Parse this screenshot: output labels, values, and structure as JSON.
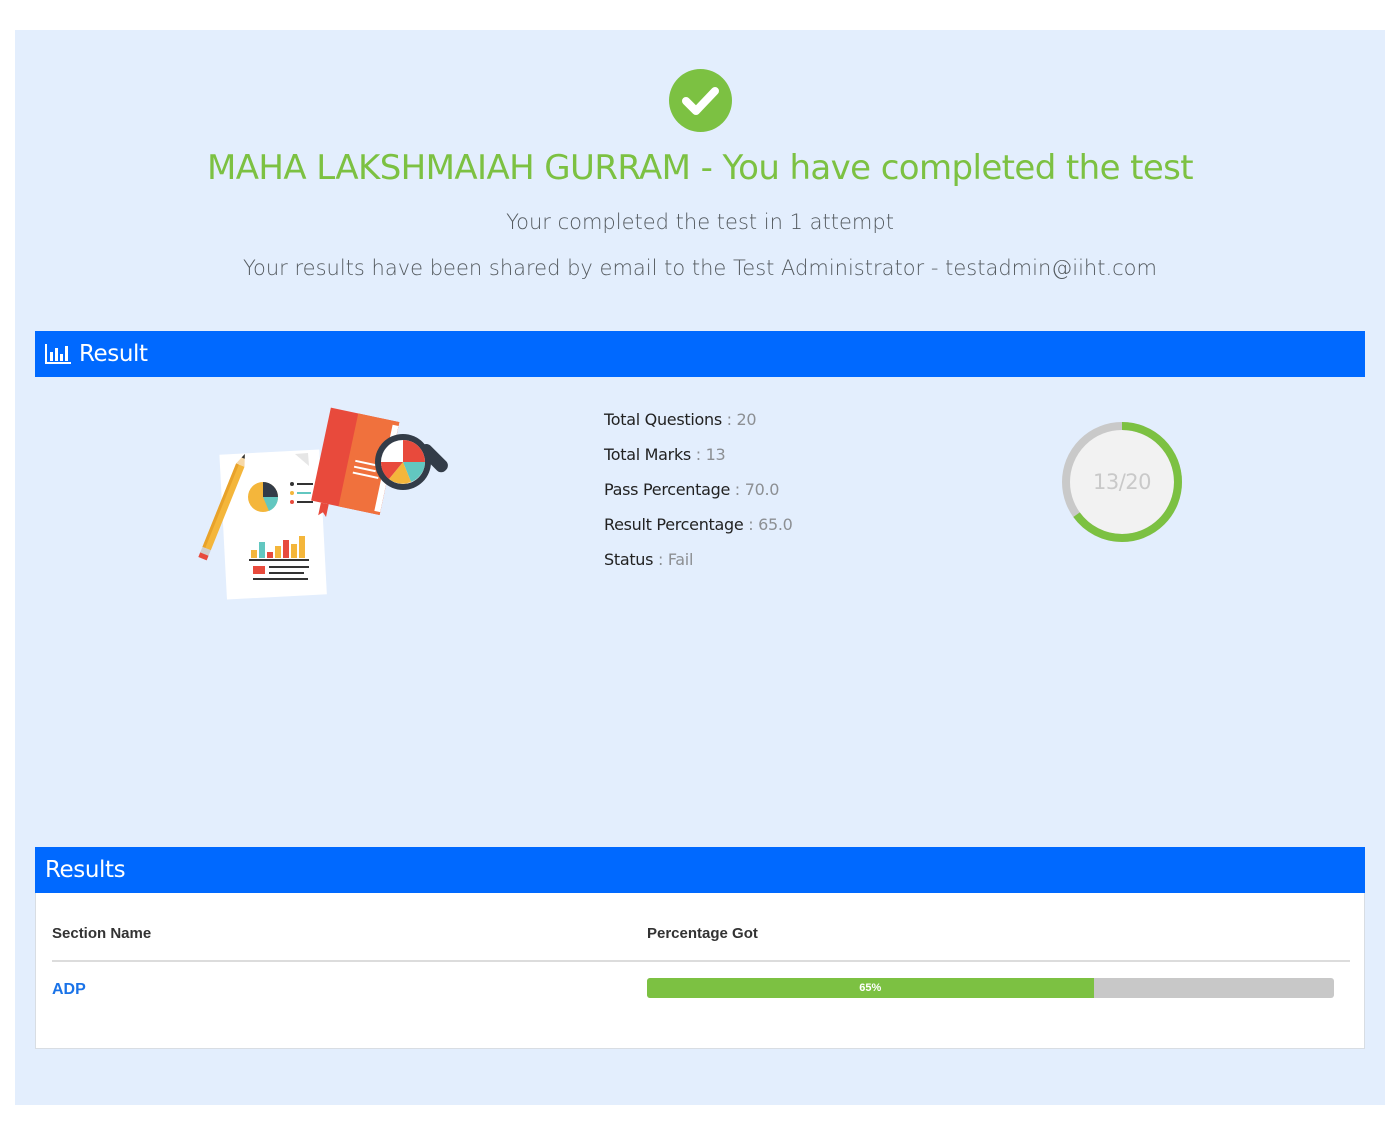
{
  "header": {
    "headline": "MAHA LAKSHMAIAH GURRAM - You have completed the test",
    "attempt_text": "Your completed the test in 1 attempt",
    "shared_text": "Your results have been shared by email to the Test Administrator - testadmin@iiht.com"
  },
  "result_section": {
    "title": "Result",
    "icon": "bar-chart-icon",
    "illustration": "report-analysis-illustration",
    "stats": [
      {
        "label": "Total Questions",
        "value": "20"
      },
      {
        "label": "Total Marks",
        "value": "13"
      },
      {
        "label": "Pass Percentage",
        "value": "70.0"
      },
      {
        "label": "Result Percentage",
        "value": "65.0"
      },
      {
        "label": "Status",
        "value": "Fail"
      }
    ],
    "score": {
      "text": "13/20",
      "obtained": 13,
      "total": 20
    }
  },
  "results_table": {
    "title": "Results",
    "columns": [
      "Section Name",
      "Percentage Got"
    ],
    "rows": [
      {
        "section": "ADP",
        "percent_label": "65%",
        "percent": 65
      }
    ]
  },
  "colors": {
    "accent_green": "#7cc142",
    "header_blue": "#0069ff",
    "page_bg": "#e3eefd",
    "link_blue": "#1a73e8",
    "progress_track": "#c8c8c8"
  }
}
